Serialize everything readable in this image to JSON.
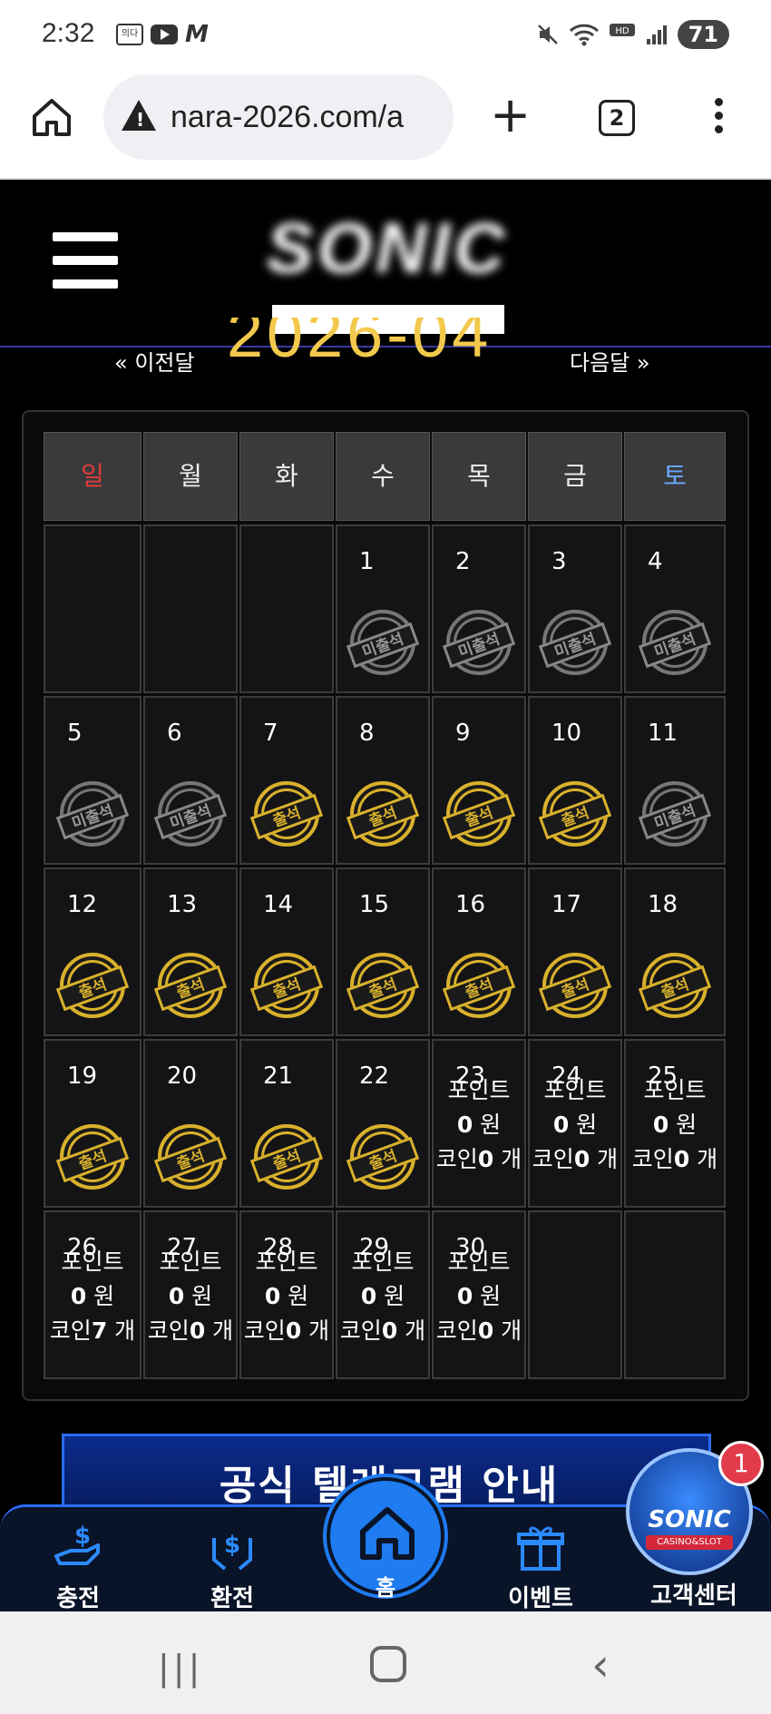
{
  "status": {
    "time": "2:32",
    "app_badge": "의다",
    "battery": "71"
  },
  "browser": {
    "url": "nara-2026.com/a",
    "tab_count": "2"
  },
  "site": {
    "logo_text": "SONIC"
  },
  "calendar": {
    "prev_label": "« 이전달",
    "month_label": "2026-04",
    "next_label": "다음달 »",
    "weekdays": [
      "일",
      "월",
      "화",
      "수",
      "목",
      "금",
      "토"
    ],
    "weekday_colors": [
      "#e23b3b",
      "#eeeeee",
      "#eeeeee",
      "#eeeeee",
      "#eeeeee",
      "#eeeeee",
      "#6aa9ff"
    ],
    "stamp_present": "출석",
    "stamp_absent": "미출석",
    "info_point_label": "포인트",
    "info_won": "원",
    "info_coin_label": "코인",
    "info_count_unit": "개",
    "days": [
      {
        "day": "1",
        "status": "absent"
      },
      {
        "day": "2",
        "status": "absent"
      },
      {
        "day": "3",
        "status": "absent"
      },
      {
        "day": "4",
        "status": "absent"
      },
      {
        "day": "5",
        "status": "absent"
      },
      {
        "day": "6",
        "status": "absent"
      },
      {
        "day": "7",
        "status": "present"
      },
      {
        "day": "8",
        "status": "present"
      },
      {
        "day": "9",
        "status": "present"
      },
      {
        "day": "10",
        "status": "present"
      },
      {
        "day": "11",
        "status": "absent"
      },
      {
        "day": "12",
        "status": "present"
      },
      {
        "day": "13",
        "status": "present"
      },
      {
        "day": "14",
        "status": "present"
      },
      {
        "day": "15",
        "status": "present"
      },
      {
        "day": "16",
        "status": "present"
      },
      {
        "day": "17",
        "status": "present"
      },
      {
        "day": "18",
        "status": "present"
      },
      {
        "day": "19",
        "status": "present"
      },
      {
        "day": "20",
        "status": "present"
      },
      {
        "day": "21",
        "status": "present"
      },
      {
        "day": "22",
        "status": "present"
      },
      {
        "day": "23",
        "status": "info",
        "points": "0",
        "coins": "0"
      },
      {
        "day": "24",
        "status": "info",
        "points": "0",
        "coins": "0"
      },
      {
        "day": "25",
        "status": "info",
        "points": "0",
        "coins": "0"
      },
      {
        "day": "26",
        "status": "info",
        "points": "0",
        "coins": "7"
      },
      {
        "day": "27",
        "status": "info",
        "points": "0",
        "coins": "0"
      },
      {
        "day": "28",
        "status": "info",
        "points": "0",
        "coins": "0"
      },
      {
        "day": "29",
        "status": "info",
        "points": "0",
        "coins": "0"
      },
      {
        "day": "30",
        "status": "info",
        "points": "0",
        "coins": "0"
      }
    ]
  },
  "banner": {
    "text": "공식 텔레그램 안내"
  },
  "nav": {
    "charge": "충전",
    "withdraw": "환전",
    "home": "홈",
    "event": "이벤트",
    "support": "고객센터",
    "support_logo": "SONIC",
    "support_sub": "CASINO&SLOT",
    "notification_count": "1"
  }
}
